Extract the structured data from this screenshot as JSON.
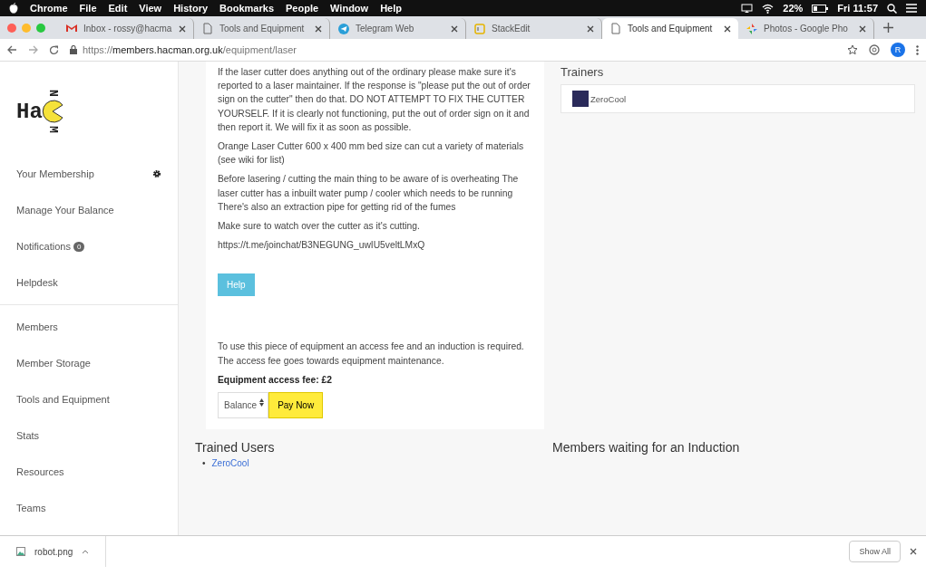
{
  "menu_bar": {
    "app": "Chrome",
    "items": [
      "File",
      "Edit",
      "View",
      "History",
      "Bookmarks",
      "People",
      "Window",
      "Help"
    ],
    "battery": "22%",
    "clock": "Fri 11:57"
  },
  "tabs": [
    {
      "title": "Inbox - rossy@hacma",
      "kind": "mail",
      "selected": false
    },
    {
      "title": "Tools and Equipment",
      "kind": "page",
      "selected": false
    },
    {
      "title": "Telegram Web",
      "kind": "telegram",
      "selected": false
    },
    {
      "title": "StackEdit",
      "kind": "stackedit",
      "selected": false
    },
    {
      "title": "Tools and Equipment",
      "kind": "page",
      "selected": true
    },
    {
      "title": "Photos - Google Pho",
      "kind": "photos",
      "selected": false
    }
  ],
  "address": {
    "scheme": "https://",
    "host": "members.hacman.org.uk",
    "path": "/equipment/laser",
    "profile": "R"
  },
  "logo": {
    "text": "Ha",
    "top": "N",
    "bottom": "M"
  },
  "sidebar": {
    "groups": [
      [
        {
          "label": "Your Membership",
          "gear": true
        },
        {
          "label": "Manage Your Balance"
        },
        {
          "label": "Notifications",
          "badge": "0"
        },
        {
          "label": "Helpdesk"
        }
      ],
      [
        {
          "label": "Members"
        },
        {
          "label": "Member Storage"
        },
        {
          "label": "Tools and Equipment"
        },
        {
          "label": "Stats"
        },
        {
          "label": "Resources"
        },
        {
          "label": "Teams"
        }
      ]
    ]
  },
  "description": [
    "If the laser cutter does anything out of the ordinary please make sure it's reported to a laser maintainer. If the response is \"please put the out of order sign on the cutter\" then do that. DO NOT ATTEMPT TO FIX THE CUTTER YOURSELF. If it is clearly not functioning, put the out of order sign on it and then report it. We will fix it as soon as possible.",
    "Orange Laser Cutter 600 x 400 mm bed size can cut a variety of materials (see wiki for list)",
    "Before lasering / cutting the main thing to be aware of is overheating The laser cutter has a inbuilt water pump / cooler which needs to be running There's also an extraction pipe for getting rid of the fumes",
    "Make sure to watch over the cutter as it's cutting.",
    "https://t.me/joinchat/B3NEGUNG_uwIU5veltLMxQ"
  ],
  "help_button": "Help",
  "fee_text": "To use this piece of equipment an access fee and an induction is required. The access fee goes towards equipment maintenance.",
  "fee_amount": "Equipment access fee: £2",
  "payment_method": "Balance",
  "pay_button": "Pay Now",
  "trainers": {
    "heading": "Trainers",
    "people": [
      "ZeroCool"
    ]
  },
  "trained_users": {
    "heading": "Trained Users",
    "bullet": "•",
    "people": [
      "ZeroCool"
    ]
  },
  "waiting": {
    "heading": "Members waiting for an Induction"
  },
  "download_bar": {
    "file": "robot.png",
    "show_all": "Show All"
  }
}
